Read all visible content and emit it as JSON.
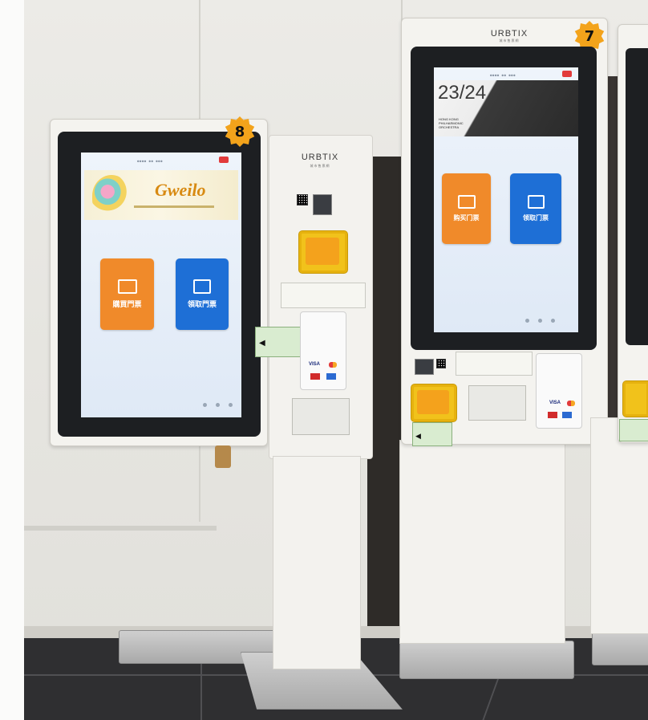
{
  "kiosk_8": {
    "badge": "8",
    "banner_title": "Gweilo",
    "buttons": [
      {
        "label": "購買門票"
      },
      {
        "label": "領取門票"
      }
    ]
  },
  "kiosk_7": {
    "badge": "7",
    "brand": "URBTIX",
    "brand_sub": "城市售票網",
    "banner_season": "23/24",
    "banner_lines": [
      "HONG KONG",
      "PHILHARMONIC",
      "ORCHESTRA"
    ],
    "buttons": [
      {
        "label": "购买门票"
      },
      {
        "label": "领取门票"
      }
    ]
  },
  "payment_stand": {
    "brand": "URBTIX",
    "brand_sub": "城市售票網",
    "card_brands": [
      "VISA"
    ]
  },
  "colors": {
    "orange_button": "#f08a2a",
    "blue_button": "#1e6fd6",
    "badge": "#f3a31b",
    "octopus": "#f1c21b"
  },
  "icons": [
    "ticket-icon",
    "ticket-collect-icon",
    "octopus-card-reader-icon",
    "qr-code-icon"
  ]
}
